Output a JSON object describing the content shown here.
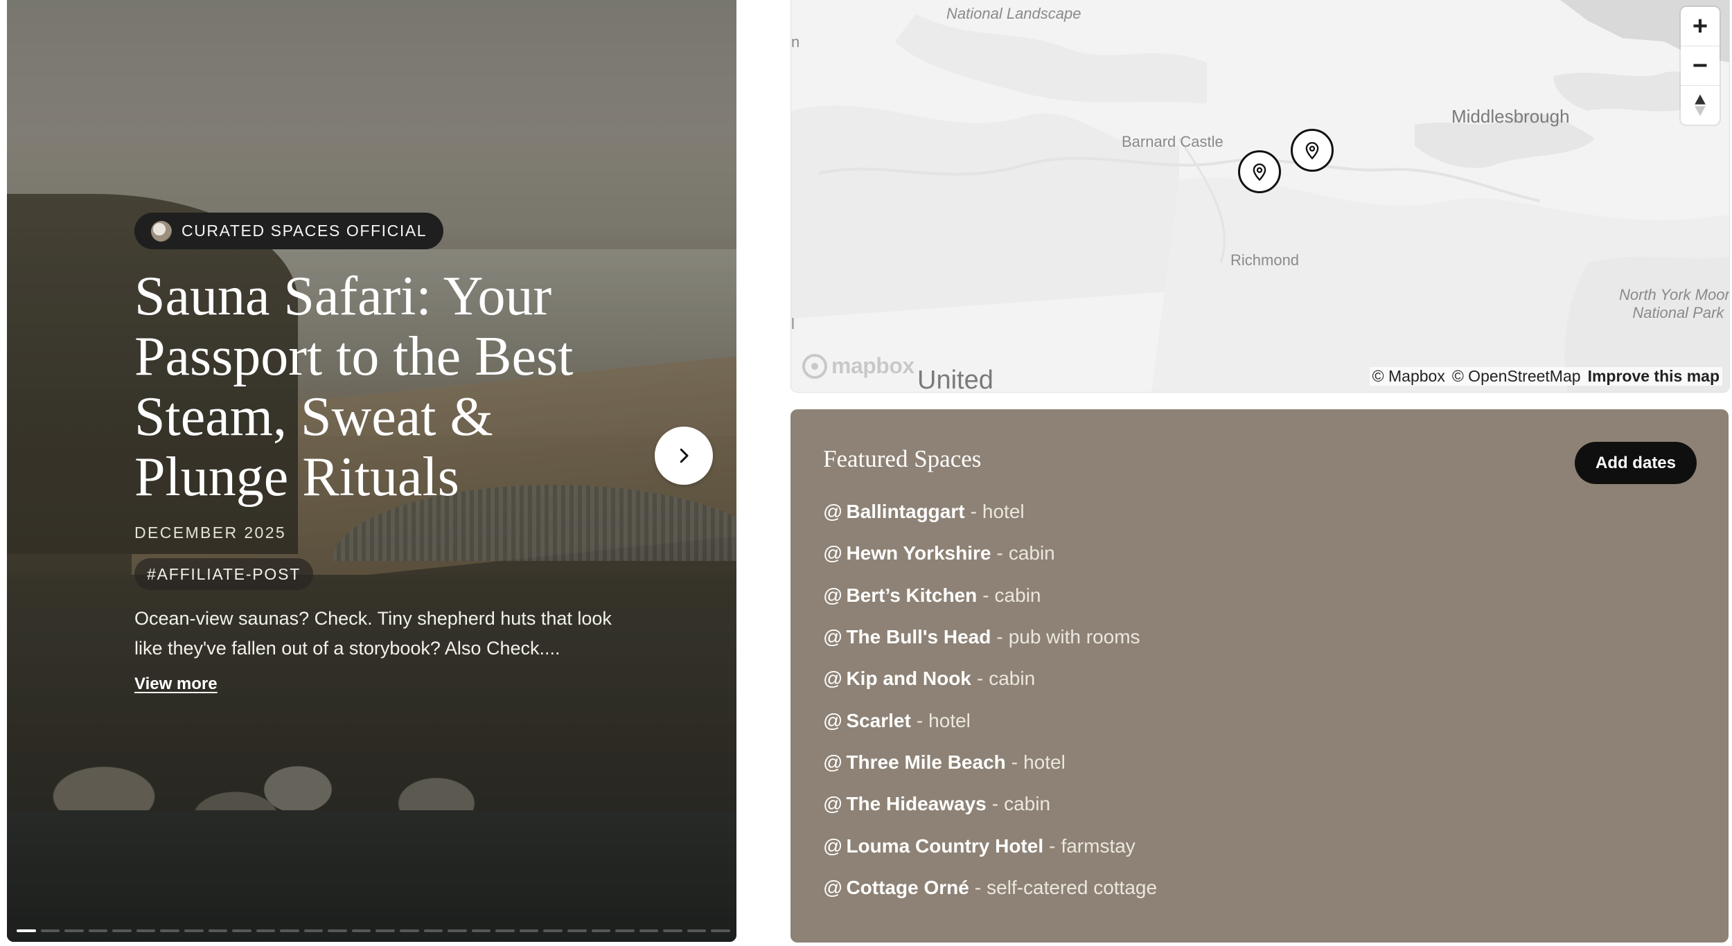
{
  "hero": {
    "author": "CURATED SPACES OFFICIAL",
    "title": "Sauna Safari: Your Passport to the Best Steam, Sweat & Plunge Rituals",
    "date": "DECEMBER 2025",
    "tag": "#AFFILIATE-POST",
    "excerpt": "Ocean-view saunas? Check. Tiny shepherd huts that look like they've fallen out of a storybook? Also Check....",
    "view_more": "View more",
    "slides_total": 30,
    "active_slide": 1,
    "next_icon": "chevron-right-icon"
  },
  "map": {
    "labels": {
      "national_landscape": "National Landscape",
      "barnard_castle": "Barnard Castle",
      "middlesbrough": "Middlesbrough",
      "richmond": "Richmond",
      "north_york_moors": "North York Moors",
      "national_park": "National Park",
      "country": "United",
      "edge_n": "n",
      "edge_l": "l"
    },
    "logo": "mapbox",
    "attribution": {
      "mapbox": "© Mapbox",
      "osm": "© OpenStreetMap",
      "improve": "Improve this map"
    },
    "controls": {
      "zoom_in": "+",
      "zoom_out": "−",
      "compass_icon": "compass-icon"
    },
    "markers": [
      {
        "name": "pin-1"
      },
      {
        "name": "pin-2"
      }
    ]
  },
  "featured": {
    "title": "Featured Spaces",
    "add_dates_label": "Add dates",
    "spaces": [
      {
        "at": "@",
        "name": "Ballintaggart",
        "sep": "-",
        "type": "hotel"
      },
      {
        "at": "@",
        "name": "Hewn Yorkshire",
        "sep": "-",
        "type": "cabin"
      },
      {
        "at": "@",
        "name": "Bert’s Kitchen",
        "sep": "-",
        "type": "cabin"
      },
      {
        "at": "@",
        "name": "The Bull's Head",
        "sep": "-",
        "type": "pub with rooms"
      },
      {
        "at": "@",
        "name": "Kip and Nook",
        "sep": "-",
        "type": "cabin"
      },
      {
        "at": "@",
        "name": "Scarlet",
        "sep": "-",
        "type": "hotel"
      },
      {
        "at": "@",
        "name": "Three Mile Beach",
        "sep": "-",
        "type": "hotel"
      },
      {
        "at": "@",
        "name": "The Hideaways",
        "sep": "-",
        "type": "cabin"
      },
      {
        "at": "@",
        "name": "Louma Country Hotel",
        "sep": "-",
        "type": "farmstay"
      },
      {
        "at": "@",
        "name": "Cottage Orné",
        "sep": "-",
        "type": "self-catered cottage"
      }
    ]
  },
  "colors": {
    "panel_bg": "#8d8275",
    "button_bg": "#0f0f0f",
    "map_bg": "#f2f2f2"
  }
}
